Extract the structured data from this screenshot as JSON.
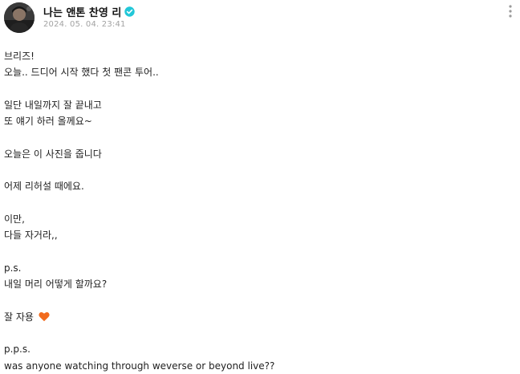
{
  "post": {
    "author": {
      "name": "나는 앤톤 찬영 리",
      "verified_icon": "verified-badge-icon",
      "verified_color": "#22c7d8"
    },
    "timestamp": "2024. 05. 04. 23:41",
    "menu_icon": "more-vertical-icon",
    "lines": [
      "브리즈!",
      "오늘.. 드디어 시작 했다 첫 팬콘 투어..",
      "",
      "일단 내일까지 잘 끝내고",
      "또 얘기 하러 올께요~",
      "",
      "오늘은 이 사진을 줍니다",
      "",
      "어제 리허설 때에요.",
      "",
      "이만,",
      "다들 자거라,,",
      "",
      "p.s.",
      "내일 머리 어떻게 할까요?",
      "",
      "잘 자용",
      "",
      "p.p.s.",
      "was anyone watching through weverse or beyond live??"
    ],
    "heart_icon": "orange-heart-icon",
    "heart_color": "#f26b1d"
  }
}
